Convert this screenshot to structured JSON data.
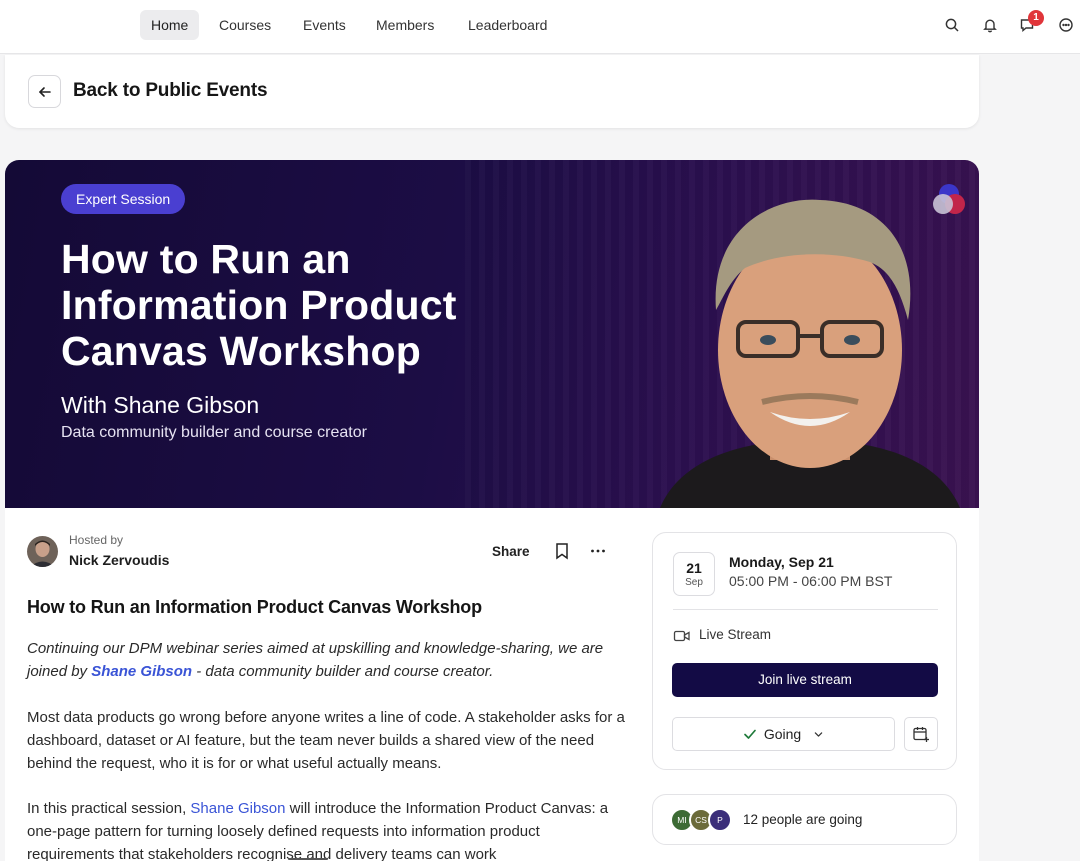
{
  "nav": {
    "items": [
      {
        "label": "Home",
        "active": true
      },
      {
        "label": "Courses",
        "active": false
      },
      {
        "label": "Events",
        "active": false
      },
      {
        "label": "Members",
        "active": false
      },
      {
        "label": "Leaderboard",
        "active": false
      }
    ],
    "icons": [
      "search-icon",
      "bell-icon",
      "messages-icon",
      "chat-icon"
    ],
    "notification_count": "1"
  },
  "back": {
    "icon": "arrow-left-icon",
    "label": "Back to Public Events"
  },
  "banner": {
    "badge": "Expert Session",
    "title": "How to Run an Information Product Canvas Workshop",
    "with": "With Shane Gibson",
    "subtitle": "Data community builder and course creator"
  },
  "host": {
    "hosted_by_label": "Hosted by",
    "name": "Nick Zervoudis"
  },
  "actions": {
    "share_label": "Share",
    "bookmark_icon": "bookmark-icon",
    "more_icon": "more-icon"
  },
  "event": {
    "title": "How to Run an Information Product Canvas Workshop",
    "intro_before": "Continuing our DPM webinar series aimed at upskilling and knowledge-sharing, we are joined by ",
    "intro_link": "Shane Gibson",
    "intro_after": " - data community builder and course creator.",
    "para2": "Most data products go wrong before anyone writes a line of code. A stakeholder asks for a dashboard, dataset or AI feature, but the team never builds a shared view of the need behind the request, who it is for or what useful actually means.",
    "para3_before": "In this practical session, ",
    "para3_link": "Shane Gibson",
    "para3_after": " will introduce the Information Product Canvas: a one-page pattern for turning loosely defined requests into information product requirements that stakeholders recognise and delivery teams can work"
  },
  "schedule": {
    "day": "21",
    "month": "Sep",
    "date_label": "Monday, Sep 21",
    "time_range": "05:00 PM - 06:00 PM BST",
    "location_type": "Live Stream",
    "join_label": "Join live stream",
    "going_label": "Going",
    "calendar_icon": "calendar-add-icon"
  },
  "attendees": {
    "initials": [
      "MI",
      "CS",
      "P"
    ],
    "colors": [
      "#3d6b35",
      "#6b6b3a",
      "#3b2e7a"
    ],
    "summary": "12 people are going"
  },
  "colors": {
    "accent": "#130b45",
    "link": "#3a54d6",
    "badge": "#4a3fd1",
    "notification": "#e0353a"
  }
}
